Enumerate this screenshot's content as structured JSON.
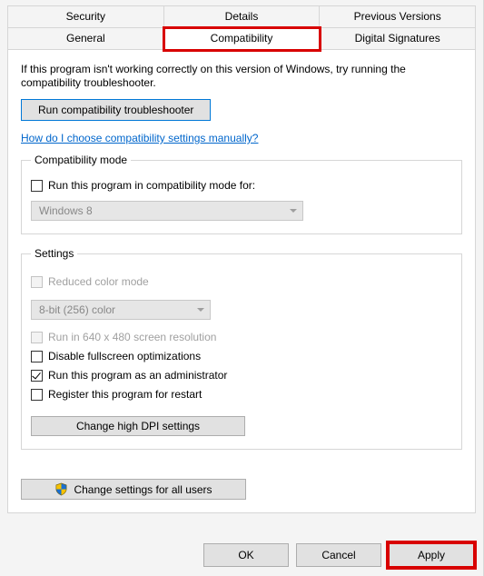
{
  "tabs": {
    "row1": [
      "Security",
      "Details",
      "Previous Versions"
    ],
    "row2": [
      "General",
      "Compatibility",
      "Digital Signatures"
    ],
    "active": "Compatibility"
  },
  "intro": "If this program isn't working correctly on this version of Windows, try running the compatibility troubleshooter.",
  "troubleshooter_btn": "Run compatibility troubleshooter",
  "manual_link": "How do I choose compatibility settings manually?",
  "compat_mode": {
    "legend": "Compatibility mode",
    "checkbox_label": "Run this program in compatibility mode for:",
    "selected": "Windows 8"
  },
  "settings": {
    "legend": "Settings",
    "reduced_color_label": "Reduced color mode",
    "color_selected": "8-bit (256) color",
    "run_640_label": "Run in 640 x 480 screen resolution",
    "disable_fullscreen_label": "Disable fullscreen optimizations",
    "run_admin_label": "Run this program as an administrator",
    "register_restart_label": "Register this program for restart",
    "dpi_btn": "Change high DPI settings"
  },
  "all_users_btn": "Change settings for all users",
  "footer": {
    "ok": "OK",
    "cancel": "Cancel",
    "apply": "Apply"
  }
}
